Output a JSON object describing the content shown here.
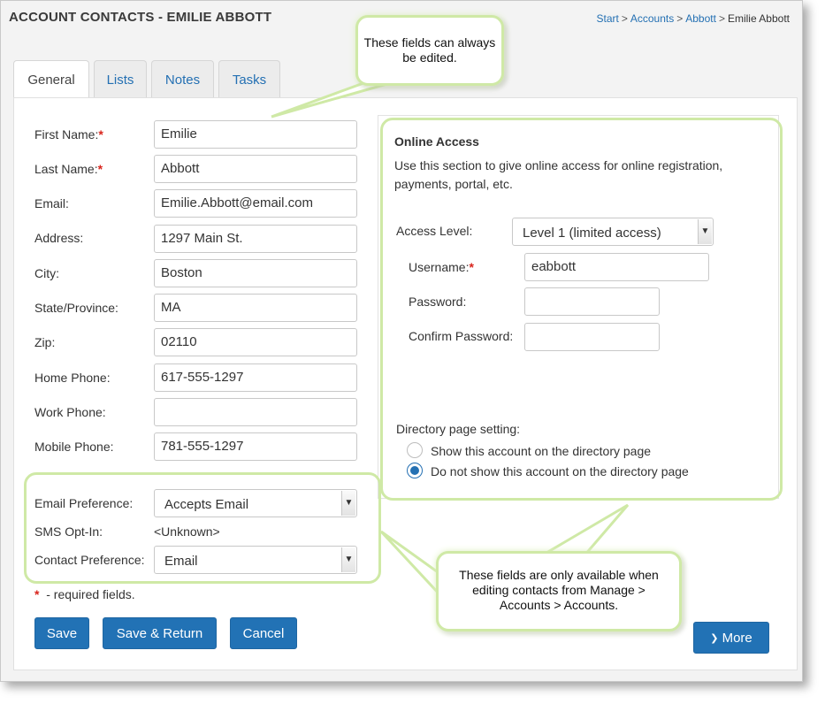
{
  "header": {
    "title": "ACCOUNT CONTACTS - EMILIE ABBOTT",
    "breadcrumb": [
      {
        "label": "Start"
      },
      {
        "label": "Accounts"
      },
      {
        "label": "Abbott"
      },
      {
        "label": "Emilie Abbott"
      }
    ],
    "separator": ">"
  },
  "tabs": [
    {
      "label": "General",
      "active": true
    },
    {
      "label": "Lists"
    },
    {
      "label": "Notes"
    },
    {
      "label": "Tasks"
    }
  ],
  "form": {
    "required_mark": "*",
    "fields": [
      {
        "label": "First Name:",
        "value": "Emilie",
        "required": true
      },
      {
        "label": "Last Name:",
        "value": "Abbott",
        "required": true
      },
      {
        "label": "Email:",
        "value": "Emilie.Abbott@email.com"
      },
      {
        "label": "Address:",
        "value": "1297 Main St."
      },
      {
        "label": "City:",
        "value": "Boston"
      },
      {
        "label": "State/Province:",
        "value": "MA"
      },
      {
        "label": "Zip:",
        "value": "02110"
      },
      {
        "label": "Home Phone:",
        "value": "617-555-1297"
      },
      {
        "label": "Work Phone:",
        "value": ""
      },
      {
        "label": "Mobile Phone:",
        "value": "781-555-1297"
      }
    ],
    "email_preference": {
      "label": "Email Preference:",
      "value": "Accepts Email"
    },
    "sms_opt_in": {
      "label": "SMS Opt-In:",
      "value": "<Unknown>"
    },
    "contact_preference": {
      "label": "Contact Preference:",
      "value": "Email"
    },
    "required_note": "- required fields."
  },
  "online_access": {
    "title": "Online Access",
    "description": "Use this section to give online access for online registration, payments, portal, etc.",
    "access_level": {
      "label": "Access Level:",
      "value": "Level 1 (limited access)"
    },
    "username": {
      "label": "Username:",
      "value": "eabbott"
    },
    "password": {
      "label": "Password:",
      "value": ""
    },
    "confirm_password": {
      "label": "Confirm Password:",
      "value": ""
    },
    "directory": {
      "label": "Directory page setting:",
      "options": [
        {
          "label": "Show this account on the directory page",
          "selected": false
        },
        {
          "label": "Do not show this account on the directory page",
          "selected": true
        }
      ]
    }
  },
  "buttons": {
    "save": "Save",
    "save_return": "Save & Return",
    "cancel": "Cancel",
    "more": "More"
  },
  "callouts": {
    "top": "These fields can always be edited.",
    "bottom": "These fields are only available when editing contacts from Manage > Accounts > Accounts."
  },
  "colors": {
    "link": "#2470b3",
    "button": "#2272b5",
    "required": "#d9241c",
    "highlight": "#cfe9a6"
  }
}
